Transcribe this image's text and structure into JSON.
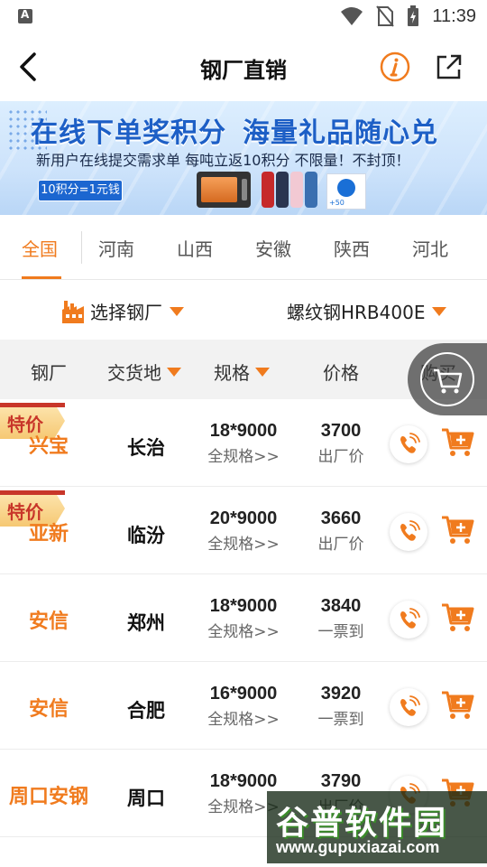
{
  "status_bar": {
    "time": "11:39"
  },
  "header": {
    "title": "钢厂直销"
  },
  "banner": {
    "headline_left": "在线下单奖积分",
    "headline_right": "海量礼品随心兑",
    "subtext": "新用户在线提交需求单  每吨立返10积分  不限量！不封顶！",
    "badge": "10积分=1元钱"
  },
  "region_tabs": [
    "全国",
    "河南",
    "山西",
    "安徽",
    "陕西",
    "河北"
  ],
  "active_region": "全国",
  "filters": {
    "mill_select": "选择钢厂",
    "product_select": "螺纹钢HRB400E"
  },
  "table_header": {
    "mill": "钢厂",
    "delivery": "交货地",
    "spec": "规格",
    "price": "价格",
    "buy": "购买"
  },
  "rows": [
    {
      "special": "特价",
      "mill": "兴宝",
      "place": "长治",
      "spec": "18*9000",
      "spec_sub": "全规格>>",
      "price": "3700",
      "price_sub": "出厂价"
    },
    {
      "special": "特价",
      "mill": "亚新",
      "place": "临汾",
      "spec": "20*9000",
      "spec_sub": "全规格>>",
      "price": "3660",
      "price_sub": "出厂价"
    },
    {
      "special": "",
      "mill": "安信",
      "place": "郑州",
      "spec": "18*9000",
      "spec_sub": "全规格>>",
      "price": "3840",
      "price_sub": "一票到"
    },
    {
      "special": "",
      "mill": "安信",
      "place": "合肥",
      "spec": "16*9000",
      "spec_sub": "全规格>>",
      "price": "3920",
      "price_sub": "一票到"
    },
    {
      "special": "",
      "mill": "周口安钢",
      "place": "周口",
      "spec": "18*9000",
      "spec_sub": "全规格>>",
      "price": "3790",
      "price_sub": "出厂价"
    }
  ],
  "watermark": {
    "title": "谷普软件园",
    "url": "www.gupuxiazai.com"
  },
  "colors": {
    "accent": "#f07b1e",
    "special_tag": "#c8362a",
    "banner_blue": "#1d5fc6"
  }
}
